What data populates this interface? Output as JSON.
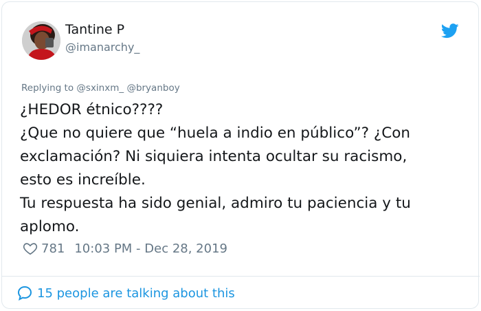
{
  "author": {
    "display_name": "Tantine P",
    "handle": "@imanarchy_"
  },
  "reply": {
    "prefix": "Replying to",
    "mentions": [
      "@sxinxm_",
      "@bryanboy"
    ]
  },
  "tweet": {
    "lines": [
      "¿HEDOR étnico????",
      "¿Que no quiere que “huela a indio en público”? ¿Con",
      "exclamación? Ni siquiera intenta ocultar su racismo,",
      "esto es increíble.",
      "Tu respuesta ha sido genial, admiro tu paciencia y tu",
      "aplomo."
    ]
  },
  "meta": {
    "likes": "781",
    "timestamp": "10:03 PM - Dec 28, 2019"
  },
  "footer": {
    "talking_text": "15 people are talking about this"
  },
  "colors": {
    "twitter_blue": "#1b95e0",
    "secondary_text": "#657786",
    "border": "#e1e8ed"
  },
  "icons": {
    "logo": "twitter-bird-icon",
    "like": "heart-icon",
    "talking": "speech-bubble-icon"
  }
}
